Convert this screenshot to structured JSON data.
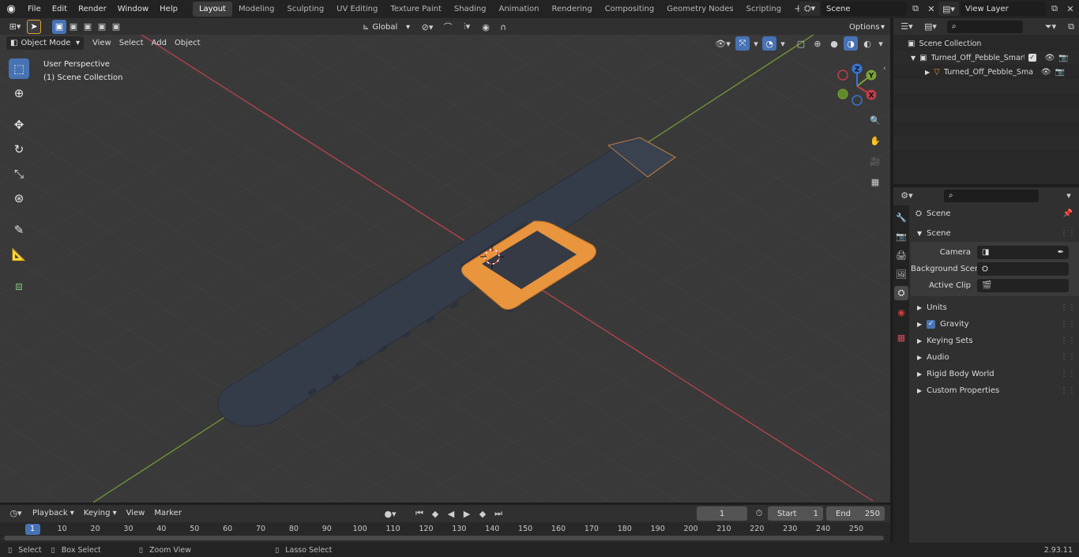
{
  "menubar": {
    "menus": [
      "File",
      "Edit",
      "Render",
      "Window",
      "Help"
    ],
    "workspaces": [
      "Layout",
      "Modeling",
      "Sculpting",
      "UV Editing",
      "Texture Paint",
      "Shading",
      "Animation",
      "Rendering",
      "Compositing",
      "Geometry Nodes",
      "Scripting"
    ],
    "active_workspace": "Layout",
    "add_workspace": "+",
    "scene_name": "Scene",
    "view_layer": "View Layer"
  },
  "viewport_header": {
    "mode": "Object Mode",
    "menus": [
      "View",
      "Select",
      "Add",
      "Object"
    ],
    "transform_orientation": "Global",
    "options_label": "Options"
  },
  "viewport": {
    "perspective_label": "User Perspective",
    "collection_label": "(1) Scene Collection",
    "gizmo_axes": {
      "x": "X",
      "y": "Y",
      "z": "Z"
    },
    "tools": [
      "select-box",
      "cursor",
      "move",
      "rotate",
      "scale",
      "transform",
      "annotate",
      "measure",
      "add-cube"
    ]
  },
  "outliner": {
    "search_placeholder": "",
    "root": "Scene Collection",
    "items": [
      {
        "label": "Turned_Off_Pebble_Smart_W",
        "type": "collection",
        "checked": true
      },
      {
        "label": "Turned_Off_Pebble_Sma",
        "type": "object"
      }
    ]
  },
  "properties": {
    "search_placeholder": "",
    "context_title": "Scene",
    "section_title": "Scene",
    "fields": [
      {
        "label": "Camera",
        "value": ""
      },
      {
        "label": "Background Scene",
        "value": ""
      },
      {
        "label": "Active Clip",
        "value": ""
      }
    ],
    "panels": [
      {
        "label": "Units",
        "checkbox": false
      },
      {
        "label": "Gravity",
        "checkbox": true
      },
      {
        "label": "Keying Sets",
        "checkbox": false
      },
      {
        "label": "Audio",
        "checkbox": false
      },
      {
        "label": "Rigid Body World",
        "checkbox": false
      },
      {
        "label": "Custom Properties",
        "checkbox": false
      }
    ]
  },
  "timeline": {
    "menus": [
      "Playback",
      "Keying",
      "View",
      "Marker"
    ],
    "current_frame": "1",
    "start_label": "Start",
    "start_value": "1",
    "end_label": "End",
    "end_value": "250",
    "ruler_ticks": [
      "1",
      "10",
      "20",
      "30",
      "40",
      "50",
      "60",
      "70",
      "80",
      "90",
      "100",
      "110",
      "120",
      "130",
      "140",
      "150",
      "160",
      "170",
      "180",
      "190",
      "200",
      "210",
      "220",
      "230",
      "240",
      "250"
    ]
  },
  "statusbar": {
    "items": [
      "Select",
      "Box Select",
      "Zoom View",
      "Lasso Select"
    ],
    "version": "2.93.11"
  },
  "colors": {
    "accent": "#4772b3",
    "watch_orange": "#e8953e",
    "x_axis": "#c33c47",
    "y_axis": "#7aa33a",
    "z_axis": "#3a74d1"
  }
}
